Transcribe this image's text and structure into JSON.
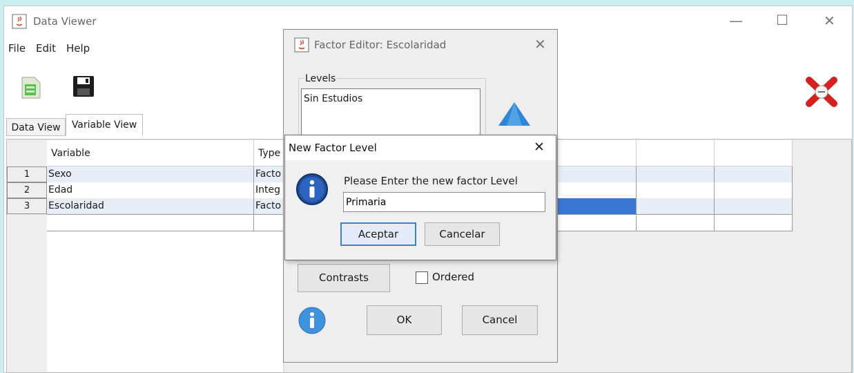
{
  "main_window": {
    "title": "Data Viewer",
    "menu": [
      "File",
      "Edit",
      "Help"
    ],
    "controls": {
      "minimize": "—",
      "maximize": "☐",
      "close": "✕"
    },
    "tabs": [
      {
        "label": "Data View",
        "active": false
      },
      {
        "label": "Variable View",
        "active": true
      }
    ]
  },
  "table": {
    "headers": [
      "Variable",
      "Type"
    ],
    "rows": [
      {
        "num": "1",
        "variable": "Sexo",
        "type": "Facto"
      },
      {
        "num": "2",
        "variable": "Edad",
        "type": "Integ"
      },
      {
        "num": "3",
        "variable": "Escolaridad",
        "type": "Facto"
      }
    ]
  },
  "factor_editor": {
    "title": "Factor Editor: Escolaridad",
    "levels_label": "Levels",
    "levels": [
      "Sin Estudios"
    ],
    "contrasts_label": "Contrasts",
    "ordered_label": "Ordered",
    "ok_label": "OK",
    "cancel_label": "Cancel"
  },
  "new_level_dialog": {
    "title": "New Factor Level",
    "message": "Please Enter the new factor Level",
    "input_value": "Primaria",
    "accept_label": "Aceptar",
    "cancel_label": "Cancelar"
  },
  "colors": {
    "accent": "#3c7fd1",
    "selected_cell": "#3a78d6",
    "background": "#cdeef0"
  }
}
